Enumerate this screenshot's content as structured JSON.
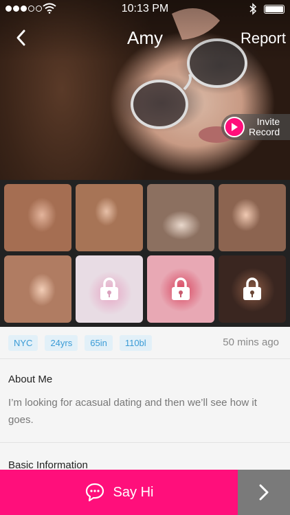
{
  "status_bar": {
    "time": "10:13 PM",
    "signal_dots_filled": 3,
    "signal_dots_total": 5,
    "icons": [
      "wifi-icon",
      "bluetooth-icon",
      "battery-icon"
    ]
  },
  "nav": {
    "title": "Amy",
    "report_label": "Report",
    "back_icon": "chevron-left-icon"
  },
  "invite": {
    "line1": "Invite",
    "line2": "Record",
    "icon": "play-icon"
  },
  "photos": [
    {
      "locked": false,
      "icon": "photo"
    },
    {
      "locked": false,
      "icon": "photo"
    },
    {
      "locked": false,
      "icon": "photo"
    },
    {
      "locked": false,
      "icon": "photo"
    },
    {
      "locked": false,
      "icon": "photo"
    },
    {
      "locked": true,
      "icon": "lock-icon"
    },
    {
      "locked": true,
      "icon": "lock-icon"
    },
    {
      "locked": true,
      "icon": "lock-icon"
    }
  ],
  "profile": {
    "tags": [
      "NYC",
      "24yrs",
      "65in",
      "110bl"
    ],
    "last_active": "50 mins ago",
    "about_title": "About Me",
    "about_text": "I’m looking for acasual dating and then we’ll see how it goes.",
    "basic_title": "Basic Information"
  },
  "actions": {
    "say_hi_label": "Say Hi",
    "say_hi_icon": "chat-bubble-icon",
    "next_icon": "chevron-right-icon"
  },
  "colors": {
    "accent": "#ff0f7b",
    "tag_bg": "#e2f0f8",
    "tag_text": "#3a9bd6",
    "next_bg": "#7a7a7a"
  }
}
